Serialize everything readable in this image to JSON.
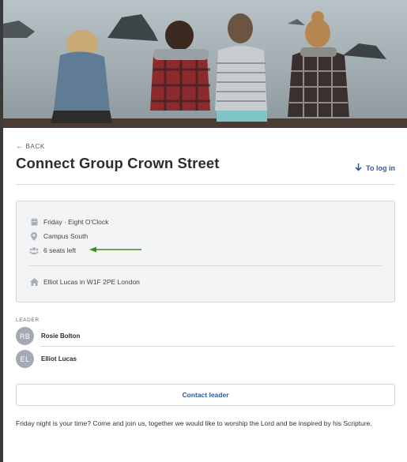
{
  "nav": {
    "back_label": "BACK",
    "login_label": "To log in"
  },
  "group": {
    "title": "Connect Group Crown Street",
    "schedule": "Friday · Eight O'Clock",
    "campus": "Campus South",
    "seats": "6 seats left",
    "host_location": "Elliot Lucas in W1F 2PE London"
  },
  "leaders": {
    "label": "LEADER",
    "people": [
      {
        "initials": "RB",
        "name": "Rosie Bolton"
      },
      {
        "initials": "EL",
        "name": "Elliot Lucas"
      }
    ]
  },
  "contact_button": "Contact leader",
  "description": "Friday night is your time? Come and join us, together we would like to worship the Lord and be inspired by his Scripture.",
  "colors": {
    "accent": "#2c59a8",
    "annotation_arrow": "#3f8a1f",
    "avatar": "#a3aab3"
  },
  "icons": [
    "arrow-left-icon",
    "arrow-down-icon",
    "calendar-icon",
    "map-pin-icon",
    "users-icon",
    "home-icon"
  ]
}
